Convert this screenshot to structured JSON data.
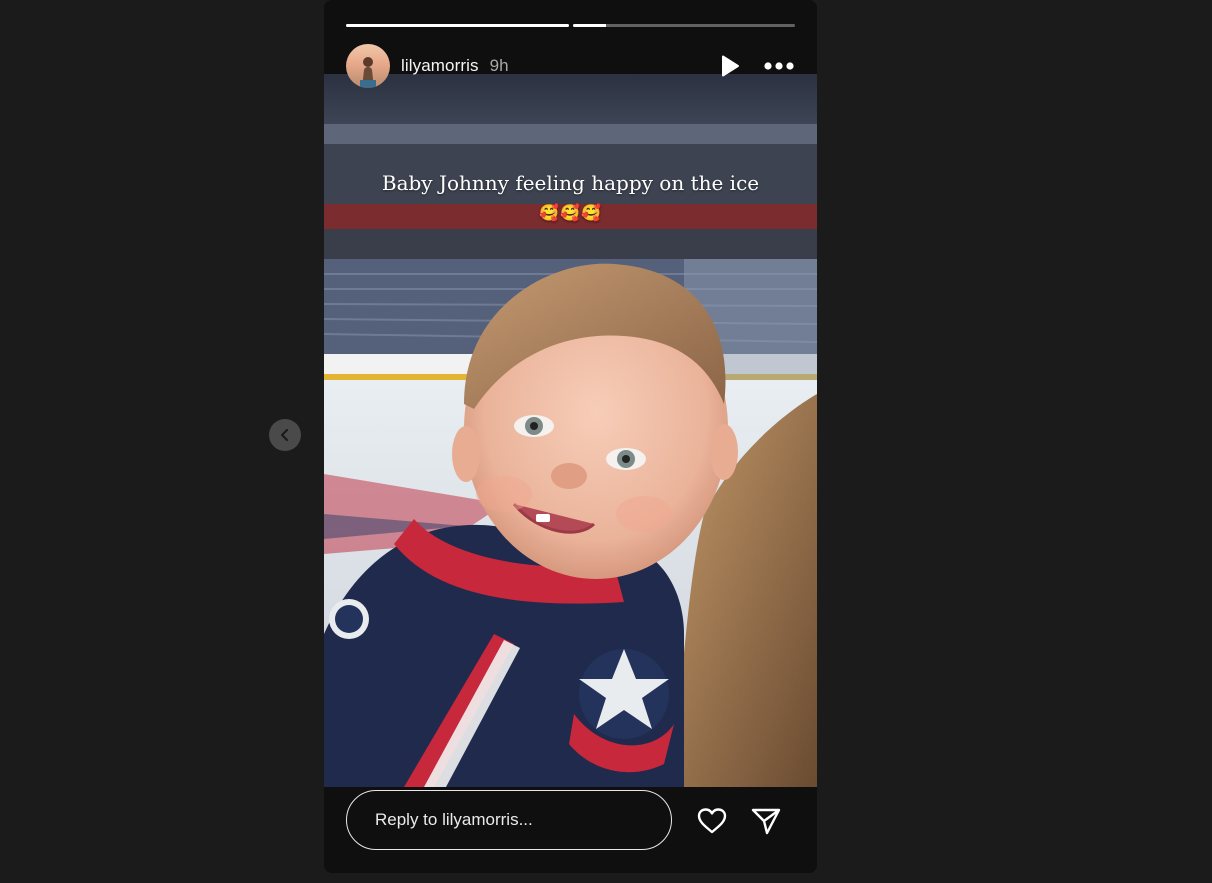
{
  "story": {
    "progress": [
      1.0,
      0.15
    ],
    "username": "lilyamorris",
    "timeago": "9h",
    "caption_line1": "Baby Johnny feeling happy on the ice",
    "caption_line2": "🥰🥰🥰"
  },
  "icons": {
    "prev": "chevron-left-icon",
    "play": "play-icon",
    "more": "more-horizontal-icon",
    "like": "heart-icon",
    "share": "paper-plane-icon"
  },
  "reply": {
    "placeholder": "Reply to lilyamorris..."
  },
  "colors": {
    "background": "#1b1b1b",
    "text": "#f4f4f4",
    "muted": "#a8a8a8"
  }
}
